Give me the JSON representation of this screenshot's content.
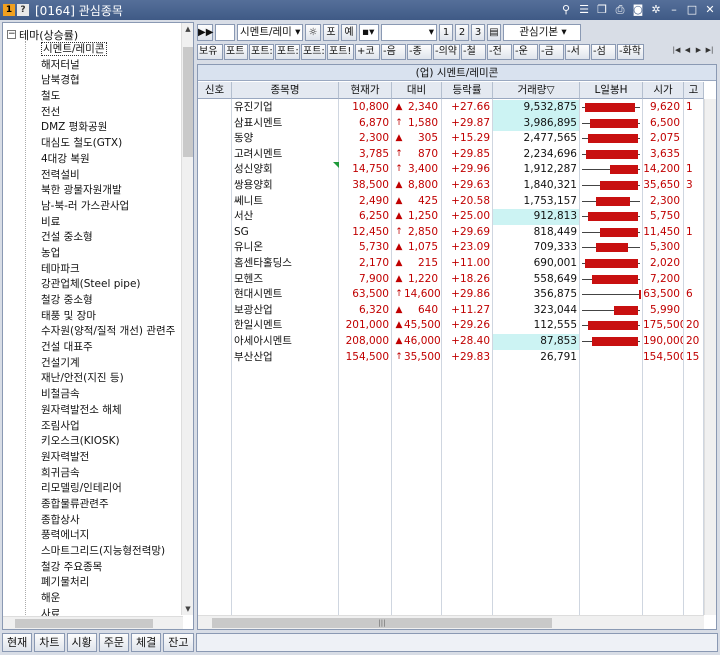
{
  "window": {
    "code": "[0164]",
    "title": "관심종목",
    "badge1": "1",
    "badge2": "?"
  },
  "tree": {
    "root_label": "테마(상승률)",
    "toggle": "−",
    "items": [
      "시멘트/레미콘",
      "해저터널",
      "남북경협",
      "철도",
      "전선",
      "DMZ 평화공원",
      "대심도 철도(GTX)",
      "4대강 복원",
      "전력설비",
      "북한 광물자원개발",
      "남-북-러 가스관사업",
      "비료",
      "건설 중소형",
      "농업",
      "테마파크",
      "강관업체(Steel pipe)",
      "철강 중소형",
      "태풍 및 장마",
      "수자원(양적/질적 개선) 관련주",
      "건설 대표주",
      "건설기계",
      "재난/안전(지진 등)",
      "비철금속",
      "원자력발전소 해체",
      "조림사업",
      "키오스크(KIOSK)",
      "원자력발전",
      "희귀금속",
      "리모델링/인테리어",
      "종합물류관련주",
      "종합상사",
      "풍력에너지",
      "스마트그리드(지능형전력망)",
      "철강 주요종목",
      "폐기물처리",
      "해운",
      "사료"
    ]
  },
  "toolbar": {
    "group_select": "시멘트/레미",
    "btn_settings": "☼",
    "btn_po": "포",
    "btn_ye": "예",
    "btn_1": "1",
    "btn_2": "2",
    "btn_3": "3",
    "view_select": "관심기본"
  },
  "filters": [
    "보유",
    "포트",
    "포트:",
    "포트:",
    "포트:",
    "포트!",
    "+코",
    "-음",
    "-종",
    "-의약",
    "-철",
    "-전",
    "-운",
    "-금",
    "-서",
    "-섬",
    "-화학"
  ],
  "grid": {
    "title": "(업) 시멘트/레미콘",
    "columns": [
      "신호",
      "종목명",
      "현재가",
      "대비",
      "등락률",
      "거래량▽",
      "L일봉H",
      "시가",
      "고"
    ],
    "rows": [
      {
        "name": "유진기업",
        "price": "10,800",
        "arrow": "▲",
        "change": "2,340",
        "rate": "+27.66",
        "volume": "9,532,875",
        "open": "9,620",
        "hi": "1",
        "hl": true,
        "bar": [
          5,
          55
        ]
      },
      {
        "name": "삼표시멘트",
        "price": "6,870",
        "arrow": "↑",
        "change": "1,580",
        "rate": "+29.87",
        "volume": "3,986,895",
        "open": "6,500",
        "hi": "",
        "hl": true,
        "bar": [
          10,
          58
        ]
      },
      {
        "name": "동양",
        "price": "2,300",
        "arrow": "▲",
        "change": "305",
        "rate": "+15.29",
        "volume": "2,477,565",
        "open": "2,075",
        "hi": "",
        "hl": false,
        "bar": [
          8,
          58
        ]
      },
      {
        "name": "고려시멘트",
        "price": "3,785",
        "arrow": "↑",
        "change": "870",
        "rate": "+29.85",
        "volume": "2,234,696",
        "open": "3,635",
        "hi": "",
        "hl": false,
        "bar": [
          6,
          58
        ]
      },
      {
        "name": "성신양회",
        "price": "14,750",
        "arrow": "↑",
        "change": "3,400",
        "rate": "+29.96",
        "volume": "1,912,287",
        "open": "14,200",
        "hi": "1",
        "hl": false,
        "bar": [
          30,
          58
        ]
      },
      {
        "name": "쌍용양회",
        "price": "38,500",
        "arrow": "▲",
        "change": "8,800",
        "rate": "+29.63",
        "volume": "1,840,321",
        "open": "35,650",
        "hi": "3",
        "hl": false,
        "bar": [
          20,
          58
        ]
      },
      {
        "name": "쎄니트",
        "price": "2,490",
        "arrow": "▲",
        "change": "425",
        "rate": "+20.58",
        "volume": "1,753,157",
        "open": "2,300",
        "hi": "",
        "hl": false,
        "bar": [
          16,
          50
        ]
      },
      {
        "name": "서산",
        "price": "6,250",
        "arrow": "▲",
        "change": "1,250",
        "rate": "+25.00",
        "volume": "912,813",
        "open": "5,750",
        "hi": "",
        "hl": true,
        "bar": [
          8,
          58
        ]
      },
      {
        "name": "SG",
        "price": "12,450",
        "arrow": "↑",
        "change": "2,850",
        "rate": "+29.69",
        "volume": "818,449",
        "open": "11,450",
        "hi": "1",
        "hl": false,
        "bar": [
          20,
          58
        ]
      },
      {
        "name": "유니온",
        "price": "5,730",
        "arrow": "▲",
        "change": "1,075",
        "rate": "+23.09",
        "volume": "709,333",
        "open": "5,300",
        "hi": "",
        "hl": false,
        "bar": [
          16,
          48
        ]
      },
      {
        "name": "홈센타홀딩스",
        "price": "2,170",
        "arrow": "▲",
        "change": "215",
        "rate": "+11.00",
        "volume": "690,001",
        "open": "2,020",
        "hi": "",
        "hl": false,
        "bar": [
          5,
          58
        ]
      },
      {
        "name": "모헨즈",
        "price": "7,900",
        "arrow": "▲",
        "change": "1,220",
        "rate": "+18.26",
        "volume": "558,649",
        "open": "7,200",
        "hi": "",
        "hl": false,
        "bar": [
          12,
          58
        ]
      },
      {
        "name": "현대시멘트",
        "price": "63,500",
        "arrow": "↑",
        "change": "14,600",
        "rate": "+29.86",
        "volume": "356,875",
        "open": "63,500",
        "hi": "6",
        "hl": false,
        "bar": [
          59,
          60
        ]
      },
      {
        "name": "보광산업",
        "price": "6,320",
        "arrow": "▲",
        "change": "640",
        "rate": "+11.27",
        "volume": "323,044",
        "open": "5,990",
        "hi": "",
        "hl": false,
        "bar": [
          34,
          58
        ]
      },
      {
        "name": "한일시멘트",
        "price": "201,000",
        "arrow": "▲",
        "change": "45,500",
        "rate": "+29.26",
        "volume": "112,555",
        "open": "175,500",
        "hi": "20",
        "hl": false,
        "bar": [
          8,
          58
        ]
      },
      {
        "name": "아세아시멘트",
        "price": "208,000",
        "arrow": "▲",
        "change": "46,000",
        "rate": "+28.40",
        "volume": "87,853",
        "open": "190,000",
        "hi": "20",
        "hl": true,
        "bar": [
          12,
          58
        ]
      },
      {
        "name": "부산산업",
        "price": "154,500",
        "arrow": "↑",
        "change": "35,500",
        "rate": "+29.83",
        "volume": "26,791",
        "open": "154,500",
        "hi": "15",
        "hl": false,
        "bar": [
          0,
          0
        ]
      }
    ]
  },
  "bottom_tabs": [
    "현재",
    "차트",
    "시황",
    "주문",
    "체결",
    "잔고"
  ],
  "colors": {
    "up": "#c00000",
    "bar": "#c81010",
    "volume_highlight": "#ccf3f3"
  }
}
